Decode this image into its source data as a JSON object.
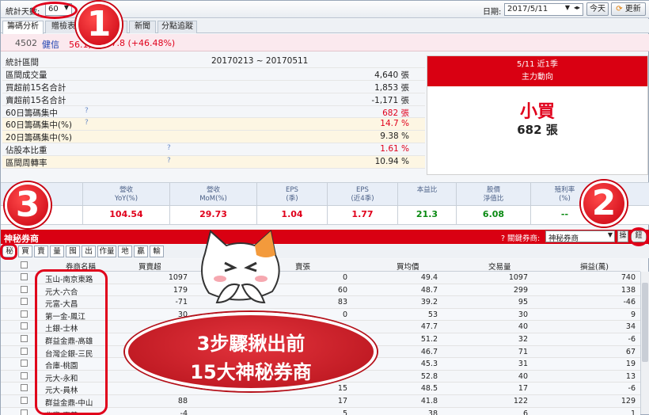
{
  "toolbar": {
    "days_label": "統計天數:",
    "days_value": "60",
    "date_label": "日期:",
    "date_value": "2017/5/11",
    "today_btn": "今天",
    "refresh_btn": "更新"
  },
  "tabs": [
    "籌碼分析",
    "贈檢表",
    "",
    "新聞",
    "分點追蹤"
  ],
  "stock": {
    "code": "4502",
    "name": "健信",
    "price": "56.1元",
    "change": "▲17.8 (+46.48%)"
  },
  "summary": {
    "range_label": "統計區間",
    "range_value": "20170213 ~ 20170511",
    "rows": [
      {
        "k": "區間成交量",
        "v": "4,640 張",
        "red": false,
        "hl": false,
        "q": false
      },
      {
        "k": "買超前15名合計",
        "v": "1,853 張",
        "red": false,
        "hl": false,
        "q": false
      },
      {
        "k": "賣超前15名合計",
        "v": "-1,171 張",
        "red": false,
        "hl": false,
        "q": false
      },
      {
        "k": "60日籌碼集中",
        "v": "682 張",
        "red": true,
        "hl": false,
        "q": true
      },
      {
        "k": "60日籌碼集中(%)",
        "v": "14.7 %",
        "red": true,
        "hl": true,
        "q": true
      },
      {
        "k": "20日籌碼集中(%)",
        "v": "9.38 %",
        "red": false,
        "hl": true,
        "q": false
      },
      {
        "k": "佔股本比重",
        "v": "1.61 %",
        "red": true,
        "hl": false,
        "q": true
      },
      {
        "k": "區間周轉率",
        "v": "10.94 %",
        "red": false,
        "hl": true,
        "q": true
      }
    ],
    "q_mark": "?"
  },
  "main_force": {
    "line1": "5/11 近1季",
    "line2": "主力動向",
    "verdict": "小買",
    "qty": "682 張"
  },
  "metrics": [
    {
      "h1": "收",
      "h2": "",
      "v": "",
      "color": ""
    },
    {
      "h1": "營收",
      "h2": "YoY(%)",
      "v": "104.54",
      "color": "red"
    },
    {
      "h1": "營收",
      "h2": "MoM(%)",
      "v": "29.73",
      "color": "red"
    },
    {
      "h1": "EPS",
      "h2": "(季)",
      "v": "1.04",
      "color": "red"
    },
    {
      "h1": "EPS",
      "h2": "(近4季)",
      "v": "1.77",
      "color": "red"
    },
    {
      "h1": "本益比",
      "h2": "",
      "v": "21.3",
      "color": "green"
    },
    {
      "h1": "股價",
      "h2": "淨值比",
      "v": "6.08",
      "color": "green"
    },
    {
      "h1": "殖利率",
      "h2": "(%)",
      "v": "--",
      "color": "green"
    },
    {
      "h1": "",
      "h2": "",
      "v": "",
      "color": ""
    }
  ],
  "brokers": {
    "title": "神秘券商",
    "filter_label": "? 關鍵券商:",
    "filter_value": "神秘券商",
    "btn_a": "操",
    "btn_b": "鈕",
    "subtabs": [
      "秘",
      "買",
      "賣",
      "量",
      "囤",
      "出",
      "作量",
      "地",
      "贏",
      "輸"
    ],
    "columns": [
      "券商名稱",
      "買賣超",
      "賣張",
      "買均價",
      "交易量",
      "損益(萬)"
    ],
    "rows": [
      {
        "name": "玉山-南京東路",
        "net": "1097",
        "sell": "0",
        "avg": "49.4",
        "vol": "1097",
        "pl": "740"
      },
      {
        "name": "元大-六合",
        "net": "179",
        "sell": "60",
        "avg": "48.7",
        "vol": "299",
        "pl": "138"
      },
      {
        "name": "元富-大昌",
        "net": "-71",
        "sell": "83",
        "avg": "39.2",
        "vol": "95",
        "pl": "-46"
      },
      {
        "name": "第一金-鳳江",
        "net": "30",
        "sell": "0",
        "avg": "53",
        "vol": "30",
        "pl": "9"
      },
      {
        "name": "土銀-士林",
        "net": "",
        "sell": "",
        "avg": "47.7",
        "vol": "40",
        "pl": "34"
      },
      {
        "name": "群益金鼎-高雄",
        "net": "",
        "sell": "",
        "avg": "51.2",
        "vol": "32",
        "pl": "-6"
      },
      {
        "name": "台灣企銀-三民",
        "net": "",
        "sell": "",
        "avg": "46.7",
        "vol": "71",
        "pl": "67"
      },
      {
        "name": "合庫-桃園",
        "net": "",
        "sell": "",
        "avg": "45.3",
        "vol": "31",
        "pl": "19"
      },
      {
        "name": "元大-永和",
        "net": "",
        "sell": "",
        "avg": "52.8",
        "vol": "40",
        "pl": "13"
      },
      {
        "name": "元大-員林",
        "net": "",
        "sell": "15",
        "avg": "48.5",
        "vol": "17",
        "pl": "-6"
      },
      {
        "name": "群益金鼎-中山",
        "net": "88",
        "sell": "17",
        "avg": "41.8",
        "vol": "122",
        "pl": "129"
      },
      {
        "name": "兆豐-嘉義",
        "net": "-4",
        "sell": "5",
        "avg": "38",
        "vol": "6",
        "pl": "1"
      }
    ]
  },
  "annotations": {
    "badge1": "1",
    "badge2": "2",
    "badge3": "3",
    "bubble_line1": "3步驟揪出前",
    "bubble_line2": "15大神秘券商"
  },
  "colors": {
    "accent_red": "#d90012",
    "up_red": "#e0001b",
    "down_green": "#0a8a12"
  }
}
